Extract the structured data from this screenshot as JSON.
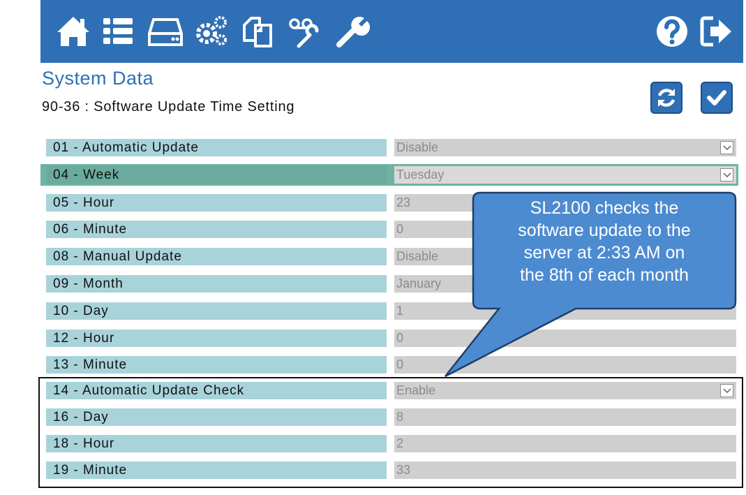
{
  "toolbar": {
    "icons": [
      "home-icon",
      "list-icon",
      "drive-icon",
      "gears-icon",
      "copy-icon",
      "voicemail-tools-icon",
      "wrench-icon",
      "help-icon",
      "logout-icon"
    ]
  },
  "header": {
    "title": "System Data",
    "subtitle": "90-36 : Software Update Time Setting"
  },
  "actions": {
    "refresh_icon": "refresh-icon",
    "apply_icon": "check-icon"
  },
  "rows": [
    {
      "label": "01 - Automatic Update",
      "value": "Disable",
      "dropdown": true
    },
    {
      "label": "04 - Week",
      "value": "Tuesday",
      "dropdown": true
    },
    {
      "label": "05 - Hour",
      "value": "23",
      "dropdown": false
    },
    {
      "label": "06 - Minute",
      "value": "0",
      "dropdown": false
    },
    {
      "label": "08 - Manual Update",
      "value": "Disable",
      "dropdown": true
    },
    {
      "label": "09 - Month",
      "value": "January",
      "dropdown": true
    },
    {
      "label": "10 - Day",
      "value": "1",
      "dropdown": false
    },
    {
      "label": "12 - Hour",
      "value": "0",
      "dropdown": false
    },
    {
      "label": "13 - Minute",
      "value": "0",
      "dropdown": false
    },
    {
      "label": "14 - Automatic Update Check",
      "value": "Enable",
      "dropdown": true
    },
    {
      "label": "16 - Day",
      "value": "8",
      "dropdown": false
    },
    {
      "label": "18 - Hour",
      "value": "2",
      "dropdown": false
    },
    {
      "label": "19 - Minute",
      "value": "33",
      "dropdown": false
    }
  ],
  "callout": {
    "lines": [
      "SL2100 checks the",
      "software update to the",
      "server at 2:33 AM on",
      "the 8th of each month"
    ]
  },
  "colors": {
    "toolbar": "#2f6fb5",
    "label_bg": "#a8d3da",
    "selected_row": "#6db3a6",
    "value_bg": "#cfcfcf",
    "callout": "#4d8bd0"
  }
}
